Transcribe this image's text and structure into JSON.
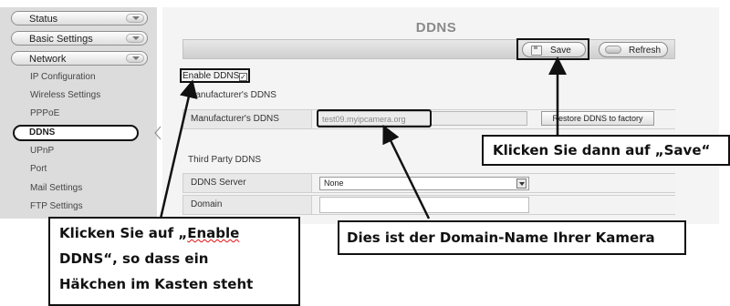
{
  "sidebar": {
    "main_items": [
      {
        "label": "Status"
      },
      {
        "label": "Basic Settings"
      },
      {
        "label": "Network"
      }
    ],
    "sub_items": [
      {
        "label": "IP Configuration"
      },
      {
        "label": "Wireless Settings"
      },
      {
        "label": "PPPoE"
      },
      {
        "label": "DDNS"
      },
      {
        "label": "UPnP"
      },
      {
        "label": "Port"
      },
      {
        "label": "Mail Settings"
      },
      {
        "label": "FTP Settings"
      }
    ],
    "active_item": "DDNS"
  },
  "page": {
    "title": "DDNS"
  },
  "toolbar": {
    "save_label": "Save",
    "refresh_label": "Refresh"
  },
  "form": {
    "enable_ddns_label": "Enable DDNS",
    "enable_ddns_checked": true,
    "manufacturers_section_label": "Manufacturer's DDNS",
    "manufacturers_row_label": "Manufacturer's DDNS",
    "manufacturers_value": "test09.myipcamera.org",
    "restore_label": "Restore DDNS to factory",
    "third_party_section_label": "Third Party DDNS",
    "ddns_server_label": "DDNS Server",
    "ddns_server_value": "None",
    "domain_label": "Domain",
    "domain_value": ""
  },
  "callouts": {
    "save": "Klicken Sie dann auf „Save“",
    "domain": "Dies ist der Domain-Name Ihrer Kamera",
    "enable_line1_a": "Klicken Sie auf „",
    "enable_line1_b": "Enable",
    "enable_line2": "DDNS“, so dass ein",
    "enable_line3": "Häkchen im Kasten steht"
  }
}
